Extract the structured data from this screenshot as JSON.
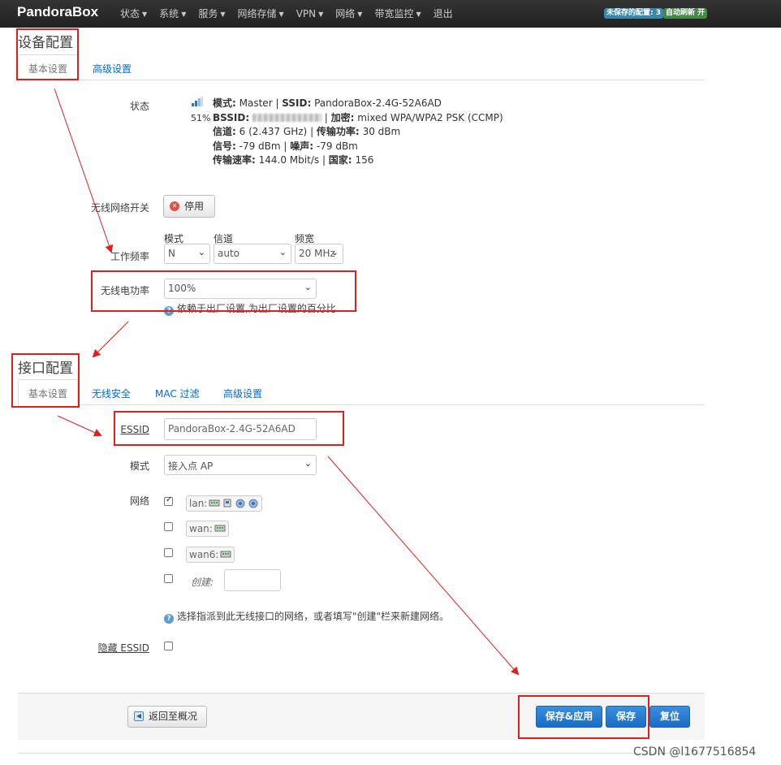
{
  "header": {
    "brand": "PandoraBox",
    "menu": [
      {
        "label": "状态",
        "dropdown": true
      },
      {
        "label": "系统",
        "dropdown": true
      },
      {
        "label": "服务",
        "dropdown": true
      },
      {
        "label": "网络存储",
        "dropdown": true
      },
      {
        "label": "VPN",
        "dropdown": true
      },
      {
        "label": "网络",
        "dropdown": true
      },
      {
        "label": "带宽监控",
        "dropdown": true
      },
      {
        "label": "退出",
        "dropdown": false
      }
    ],
    "unsaved_badge": "未保存的配置: 3",
    "refresh_badge": "自动刷新 开"
  },
  "device_config": {
    "title": "设备配置",
    "tabs": [
      "基本设置",
      "高级设置"
    ],
    "status": {
      "label": "状态",
      "signal_percent": "51%",
      "mode_label": "模式:",
      "mode_value": "Master",
      "ssid_label": "SSID:",
      "ssid_value": "PandoraBox-2.4G-52A6AD",
      "bssid_label": "BSSID:",
      "encryption_label": "加密:",
      "encryption_value": "mixed WPA/WPA2 PSK (CCMP)",
      "channel_label": "信道:",
      "channel_value": "6 (2.437 GHz)",
      "txpower_label": "传输功率:",
      "txpower_value": "30 dBm",
      "signal_label": "信号:",
      "signal_value": "-79 dBm",
      "noise_label": "噪声:",
      "noise_value": "-79 dBm",
      "bitrate_label": "传输速率:",
      "bitrate_value": "144.0 Mbit/s",
      "country_label": "国家:",
      "country_value": "156"
    },
    "wireless_switch": {
      "label": "无线网络开关",
      "button": "停用"
    },
    "frequency": {
      "label": "工作频率",
      "mode_header": "模式",
      "mode_value": "N",
      "channel_header": "信道",
      "channel_value": "auto",
      "width_header": "频宽",
      "width_value": "20 MHz"
    },
    "txpower": {
      "label": "无线电功率",
      "value": "100%",
      "help": "依赖于出厂设置,为出厂设置的百分比"
    }
  },
  "interface_config": {
    "title": "接口配置",
    "tabs": [
      "基本设置",
      "无线安全",
      "MAC 过滤",
      "高级设置"
    ],
    "essid": {
      "label": "ESSID",
      "value": "PandoraBox-2.4G-52A6AD"
    },
    "mode": {
      "label": "模式",
      "value": "接入点 AP"
    },
    "network": {
      "label": "网络",
      "options": [
        {
          "name": "lan:",
          "checked": true
        },
        {
          "name": "wan:",
          "checked": false
        },
        {
          "name": "wan6:",
          "checked": false
        }
      ],
      "create_label": "创建:",
      "help": "选择指派到此无线接口的网络，或者填写\"创建\"栏来新建网络。"
    },
    "hide_essid": {
      "label": "隐藏 ESSID",
      "checked": false
    }
  },
  "actions": {
    "back": "返回至概况",
    "save_apply": "保存&应用",
    "save": "保存",
    "reset": "复位"
  },
  "watermark": "CSDN @l1677516854"
}
